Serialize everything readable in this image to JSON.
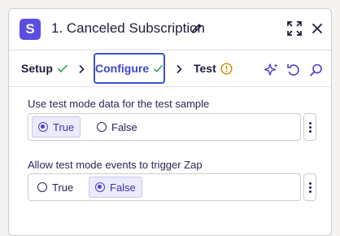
{
  "header": {
    "app_logo_letter": "S",
    "title": "1. Canceled Subscription",
    "icons": [
      "edit-icon",
      "expand-icon",
      "close-icon"
    ]
  },
  "tabs": [
    {
      "label": "Setup",
      "status": "complete"
    },
    {
      "label": "Configure",
      "status": "complete",
      "active": true
    },
    {
      "label": "Test",
      "status": "warning"
    }
  ],
  "toolbar_icons": [
    "sparkle-icon",
    "undo-icon",
    "search-icon"
  ],
  "fields": [
    {
      "label": "Use test mode data for the test sample",
      "options": [
        "True",
        "False"
      ],
      "selected": "True"
    },
    {
      "label": "Allow test mode events to trigger Zap",
      "options": [
        "True",
        "False"
      ],
      "selected": "False"
    }
  ],
  "colors": {
    "accent": "#3d48c8",
    "app_logo": "#5a4de0",
    "check": "#2e9e5b",
    "warning": "#c88a00",
    "selected_bg": "#ecebfb"
  }
}
